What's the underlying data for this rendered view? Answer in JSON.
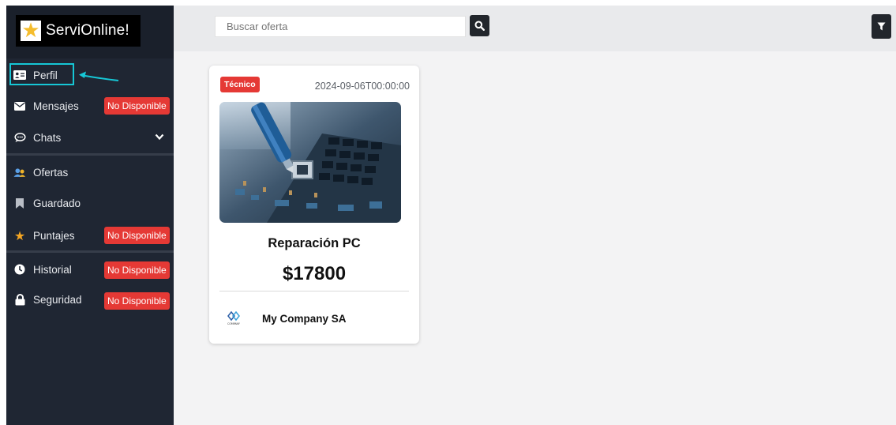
{
  "brand": {
    "name": "ServiOnline!",
    "icon": "star-icon"
  },
  "sidebar": {
    "items": [
      {
        "key": "perfil",
        "label": "Perfil",
        "icon": "id-card-icon",
        "badge": ""
      },
      {
        "key": "mensajes",
        "label": "Mensajes",
        "icon": "envelope-icon",
        "badge": "No Disponible"
      },
      {
        "key": "chats",
        "label": "Chats",
        "icon": "chat-icon",
        "badge": ""
      },
      {
        "key": "ofertas",
        "label": "Ofertas",
        "icon": "users-icon",
        "badge": ""
      },
      {
        "key": "guardado",
        "label": "Guardado",
        "icon": "bookmark-icon",
        "badge": ""
      },
      {
        "key": "puntajes",
        "label": "Puntajes",
        "icon": "star-icon",
        "badge": "No Disponible"
      },
      {
        "key": "historial",
        "label": "Historial",
        "icon": "clock-icon",
        "badge": "No Disponible"
      },
      {
        "key": "seguridad",
        "label": "Seguridad",
        "icon": "lock-icon",
        "badge": "No Disponible"
      }
    ]
  },
  "search": {
    "placeholder": "Buscar oferta",
    "value": ""
  },
  "card": {
    "category": "Técnico",
    "date": "2024-09-06T00:00:00",
    "title": "Reparación PC",
    "price": "$17800",
    "company": "My Company SA",
    "company_logo_text": "COMPANY"
  },
  "colors": {
    "sidebar": "#1f2633",
    "badge": "#e53935",
    "focus": "#16c7d6",
    "topbar": "#e9eaec",
    "content": "#f3f3f4"
  }
}
